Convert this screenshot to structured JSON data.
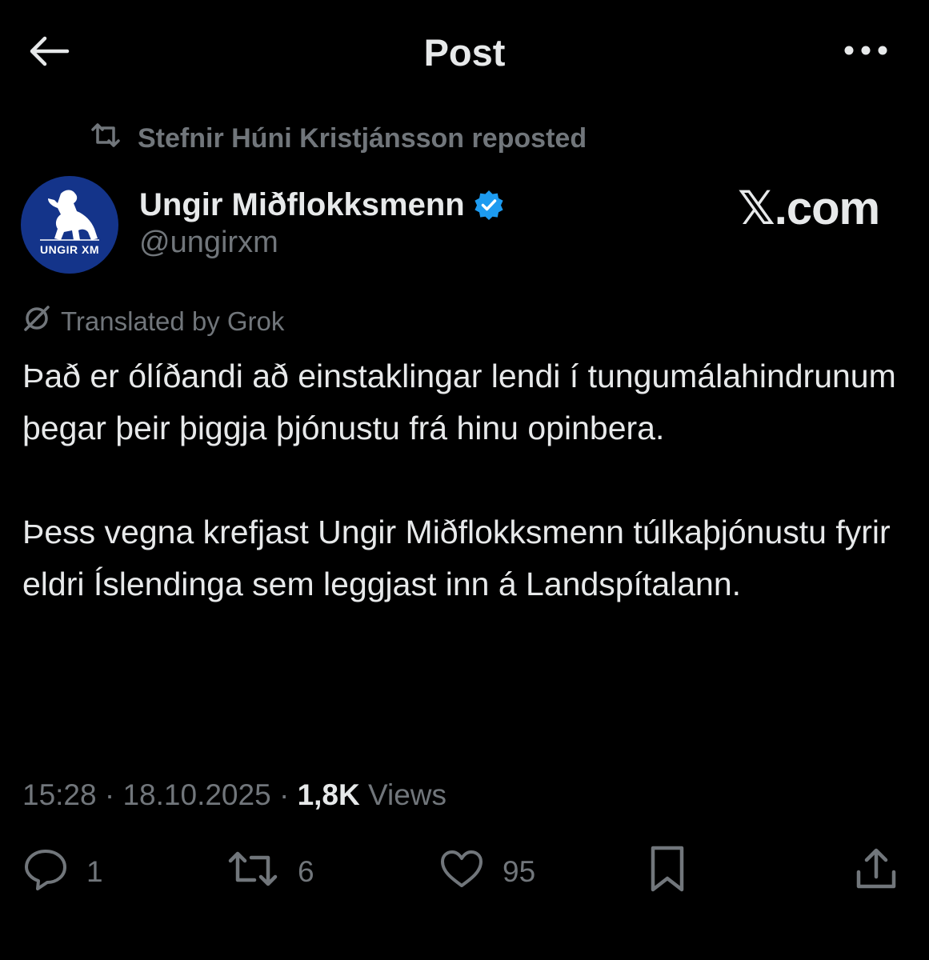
{
  "header": {
    "title": "Post",
    "back_icon": "arrow-left-icon",
    "more_icon": "more-horizontal-icon"
  },
  "repost": {
    "text": "Stefnir Húni Kristjánsson reposted",
    "icon": "repost-icon"
  },
  "author": {
    "display_name": "Ungir Miðflokksmenn",
    "handle": "@ungirxm",
    "verified": true,
    "verified_color": "#1d9bf0",
    "avatar_text": "UNGIR XM",
    "avatar_color": "#14348a"
  },
  "watermark": "𝕏.com",
  "translation": {
    "text": "Translated by Grok",
    "icon": "grok-icon"
  },
  "post": {
    "paragraph1": "Það er ólíðandi að einstaklingar lendi í tungumálahindrunum þegar þeir þiggja þjónustu frá hinu opinbera.",
    "paragraph2": "Þess vegna krefjast Ungir Miðflokksmenn túlkaþjónustu fyrir eldri Íslendinga sem leggjast inn á Landspítalann."
  },
  "meta": {
    "time": "15:28",
    "separator": " · ",
    "date": "18.10.2025",
    "views_count": "1,8K",
    "views_label": " Views"
  },
  "actions": {
    "reply_count": "1",
    "repost_count": "6",
    "like_count": "95",
    "icons": [
      "reply-icon",
      "repost-icon",
      "like-icon",
      "bookmark-icon",
      "share-icon"
    ]
  },
  "colors": {
    "background": "#000000",
    "text": "#e7e9ea",
    "muted": "#71767b"
  }
}
